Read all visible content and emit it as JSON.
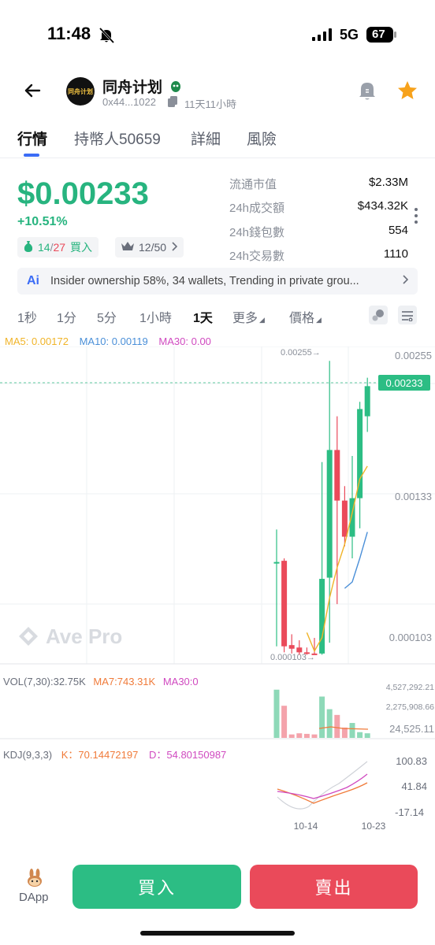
{
  "status_bar": {
    "time": "11:48",
    "network": "5G",
    "battery": "67"
  },
  "header": {
    "token_name": "同舟计划",
    "address": "0x44...1022",
    "age": "11天11小時",
    "avatar_text": "同舟计划"
  },
  "tabs": [
    {
      "label": "行情",
      "active": true
    },
    {
      "label": "持幣人50659",
      "active": false
    },
    {
      "label": "詳細",
      "active": false
    },
    {
      "label": "風險",
      "active": false
    }
  ],
  "price": {
    "value": "$0.00233",
    "change": "+10.51%",
    "buy_ratio_num": "14",
    "buy_ratio_den": "27",
    "buy_label": "買入",
    "rank": "12/50"
  },
  "stats": [
    {
      "label": "流通市值",
      "value": "$2.33M"
    },
    {
      "label": "24h成交額",
      "value": "$434.32K"
    },
    {
      "label": "24h錢包數",
      "value": "554"
    },
    {
      "label": "24h交易數",
      "value": "1110"
    }
  ],
  "ai_banner": {
    "text": "Insider ownership 58%, 34 wallets, Trending in private grou..."
  },
  "intervals": [
    {
      "label": "1秒",
      "active": false
    },
    {
      "label": "1分",
      "active": false
    },
    {
      "label": "5分",
      "active": false
    },
    {
      "label": "1小時",
      "active": false
    },
    {
      "label": "1天",
      "active": true
    },
    {
      "label": "更多",
      "active": false
    },
    {
      "label": "價格",
      "active": false
    }
  ],
  "ma_legend": {
    "ma5": "MA5: 0.00172",
    "ma10": "MA10: 0.00119",
    "ma30": "MA30: 0.00"
  },
  "colors": {
    "up": "#2cbd84",
    "down": "#ea4a5a",
    "ma5": "#f0b429",
    "ma10": "#4a8fd8",
    "ma30": "#d04ac0"
  },
  "chart_data": {
    "type": "candlestick",
    "watermark": "Ave Pro",
    "y_ticks": [
      "0.00255",
      "0.00133",
      "0.000103"
    ],
    "last_price": "0.00233",
    "high_marker": "0.00255→",
    "low_marker": "0.000103→",
    "x_ticks": [
      "10-14",
      "10-23"
    ],
    "candles": [
      {
        "o": 0.00086,
        "h": 0.00114,
        "l": 0.00017,
        "c": 0.00087
      },
      {
        "o": 0.00088,
        "h": 0.0009,
        "l": 0.00012,
        "c": 0.00017
      },
      {
        "o": 0.00018,
        "h": 0.00027,
        "l": 0.00011,
        "c": 0.00015
      },
      {
        "o": 0.00016,
        "h": 0.00022,
        "l": 0.0001,
        "c": 0.00012
      },
      {
        "o": 0.00012,
        "h": 0.00016,
        "l": 0.0001,
        "c": 0.00011
      },
      {
        "o": 0.00011,
        "h": 0.00024,
        "l": 0.0001,
        "c": 0.0001
      },
      {
        "o": 0.00011,
        "h": 0.0017,
        "l": 0.0001,
        "c": 0.00073
      },
      {
        "o": 0.00074,
        "h": 0.00254,
        "l": 0.0002,
        "c": 0.0018
      },
      {
        "o": 0.0018,
        "h": 0.00208,
        "l": 0.00052,
        "c": 0.00138
      },
      {
        "o": 0.00138,
        "h": 0.0015,
        "l": 0.001,
        "c": 0.00108
      },
      {
        "o": 0.00108,
        "h": 0.00175,
        "l": 0.0009,
        "c": 0.0014
      },
      {
        "o": 0.0014,
        "h": 0.0022,
        "l": 0.00115,
        "c": 0.00214
      },
      {
        "o": 0.00208,
        "h": 0.0024,
        "l": 0.00195,
        "c": 0.00233
      }
    ],
    "volume_legend": {
      "vol": "VOL(7,30):32.75K",
      "ma7": "MA7:743.31K",
      "ma30": "MA30:0"
    },
    "volume_ticks": [
      "4,527,292.21",
      "2,275,908.66",
      "24,525.11"
    ],
    "volumes": [
      4200000,
      2800000,
      300000,
      400000,
      350000,
      300000,
      3600000,
      2500000,
      2000000,
      900000,
      1300000,
      500000,
      400000
    ],
    "kdj_legend": {
      "kdj": "KDJ(9,3,3)",
      "k": "K：70.14472197",
      "d": "D：54.80150987"
    },
    "kdj_ticks": [
      "100.83",
      "41.84",
      "-17.14"
    ]
  },
  "actions": {
    "dapp": "DApp",
    "buy": "買入",
    "sell": "賣出"
  }
}
